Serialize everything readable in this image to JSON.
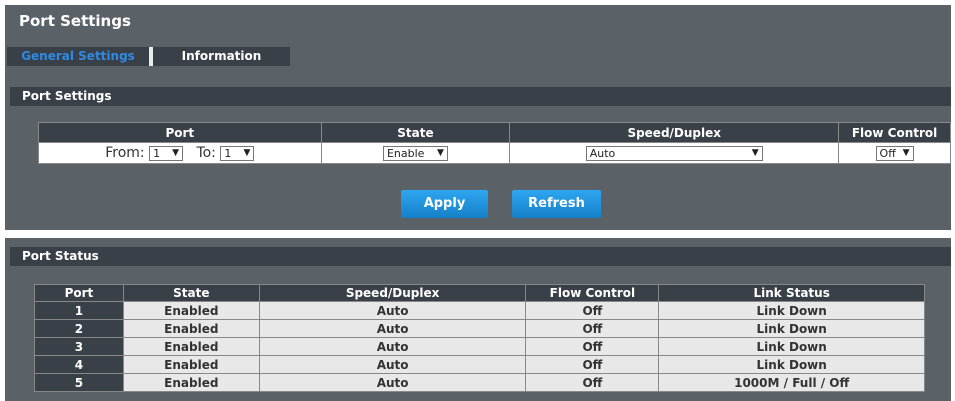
{
  "page": {
    "title": "Port Settings"
  },
  "tabs": [
    {
      "label": "General Settings",
      "active": true
    },
    {
      "label": "Information",
      "active": false
    }
  ],
  "settings": {
    "section_title": "Port Settings",
    "headers": {
      "port": "Port",
      "state": "State",
      "speed": "Speed/Duplex",
      "flow": "Flow Control"
    },
    "from_label": "From:",
    "to_label": "To:",
    "from_value": "1",
    "to_value": "1",
    "state_value": "Enable",
    "speed_value": "Auto",
    "flow_value": "Off"
  },
  "buttons": {
    "apply": "Apply",
    "refresh": "Refresh"
  },
  "status": {
    "section_title": "Port Status",
    "headers": [
      "Port",
      "State",
      "Speed/Duplex",
      "Flow Control",
      "Link Status"
    ],
    "rows": [
      [
        "1",
        "Enabled",
        "Auto",
        "Off",
        "Link Down"
      ],
      [
        "2",
        "Enabled",
        "Auto",
        "Off",
        "Link Down"
      ],
      [
        "3",
        "Enabled",
        "Auto",
        "Off",
        "Link Down"
      ],
      [
        "4",
        "Enabled",
        "Auto",
        "Off",
        "Link Down"
      ],
      [
        "5",
        "Enabled",
        "Auto",
        "Off",
        "1000M / Full / Off"
      ]
    ]
  },
  "colors": {
    "panel": "#5a6268",
    "bar": "#3a4047",
    "accent": "#2e8ae6",
    "button": "#1e90dd"
  }
}
